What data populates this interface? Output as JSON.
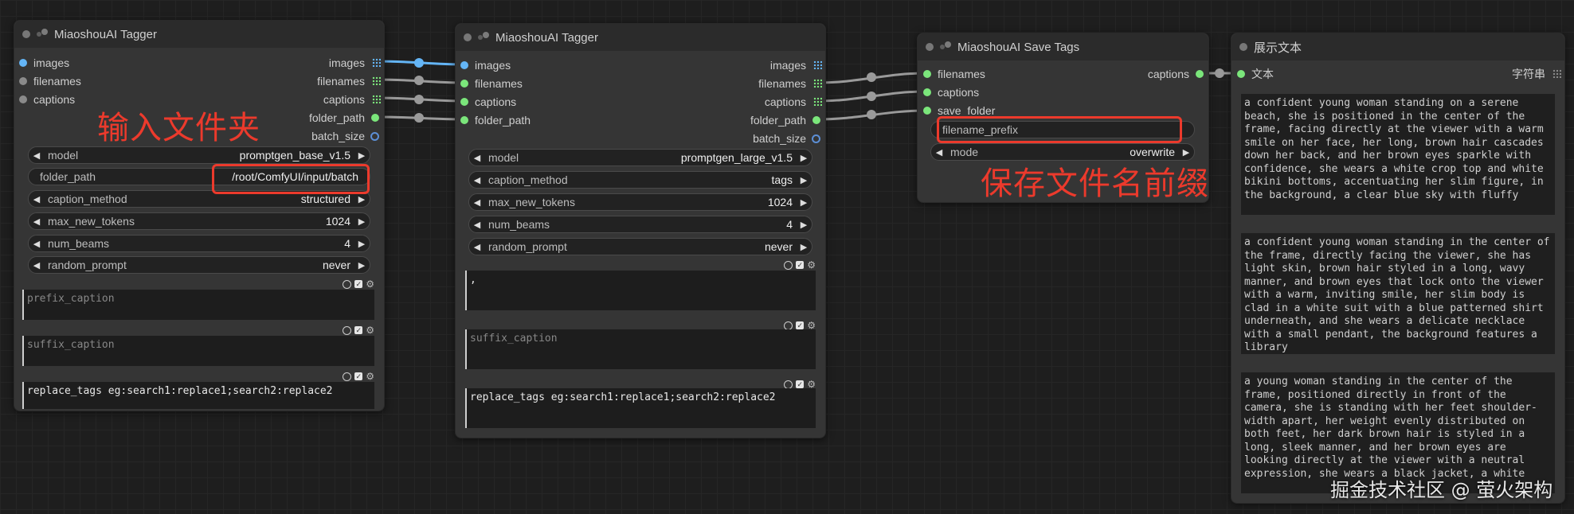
{
  "node1": {
    "title": "MiaoshouAI Tagger",
    "inputs": [
      "images",
      "filenames",
      "captions"
    ],
    "outputs": [
      "images",
      "filenames",
      "captions",
      "folder_path",
      "batch_size"
    ],
    "widgets": [
      {
        "label": "model",
        "value": "promptgen_base_v1.5"
      },
      {
        "label": "folder_path",
        "value": "/root/ComfyUI/input/batch"
      },
      {
        "label": "caption_method",
        "value": "structured"
      },
      {
        "label": "max_new_tokens",
        "value": "1024"
      },
      {
        "label": "num_beams",
        "value": "4"
      },
      {
        "label": "random_prompt",
        "value": "never"
      }
    ],
    "prefix_placeholder": "prefix_caption",
    "suffix_placeholder": "suffix_caption",
    "replace_text": "replace_tags eg:search1:replace1;search2:replace2"
  },
  "node2": {
    "title": "MiaoshouAI Tagger",
    "inputs": [
      "images",
      "filenames",
      "captions",
      "folder_path"
    ],
    "outputs": [
      "images",
      "filenames",
      "captions",
      "folder_path",
      "batch_size"
    ],
    "widgets": [
      {
        "label": "model",
        "value": "promptgen_large_v1.5"
      },
      {
        "label": "caption_method",
        "value": "tags"
      },
      {
        "label": "max_new_tokens",
        "value": "1024"
      },
      {
        "label": "num_beams",
        "value": "4"
      },
      {
        "label": "random_prompt",
        "value": "never"
      }
    ],
    "prefix_text": ",",
    "suffix_placeholder": "suffix_caption",
    "replace_text": "replace_tags eg:search1:replace1;search2:replace2"
  },
  "node3": {
    "title": "MiaoshouAI Save Tags",
    "inputs": [
      "filenames",
      "captions",
      "save_folder"
    ],
    "outputs": [
      "captions"
    ],
    "widgets": [
      {
        "label": "filename_prefix",
        "value": ""
      },
      {
        "label": "mode",
        "value": "overwrite"
      }
    ]
  },
  "node4": {
    "title": "展示文本",
    "input": "文本",
    "output": "字符串",
    "texts": [
      "a confident young woman standing on a serene beach, she is positioned in the center of the frame, facing directly at the viewer with a warm smile on her face, her long, brown hair cascades down her back, and her brown eyes sparkle with confidence, she wears a white crop top and white bikini bottoms, accentuating her slim figure, in the background, a clear blue sky with fluffy",
      "a confident young woman standing in the center of the frame, directly facing the viewer, she has light skin, brown hair styled in a long, wavy manner, and brown eyes that lock onto the viewer with a warm, inviting smile, her slim body is clad in a white suit with a blue patterned shirt underneath, and she wears a delicate necklace with a small pendant, the background features a library",
      "a young woman standing in the center of the frame, positioned directly in front of the camera, she is standing with her feet shoulder-width apart, her weight evenly distributed on both feet, her dark brown hair is styled in a long, sleek manner, and her brown eyes are looking directly at the viewer with a neutral expression, she wears a black jacket, a white"
    ]
  },
  "annotations": {
    "input_folder": "输入文件夹",
    "save_prefix": "保存文件名前缀"
  },
  "watermark": "掘金技术社区 @ 萤火架构"
}
